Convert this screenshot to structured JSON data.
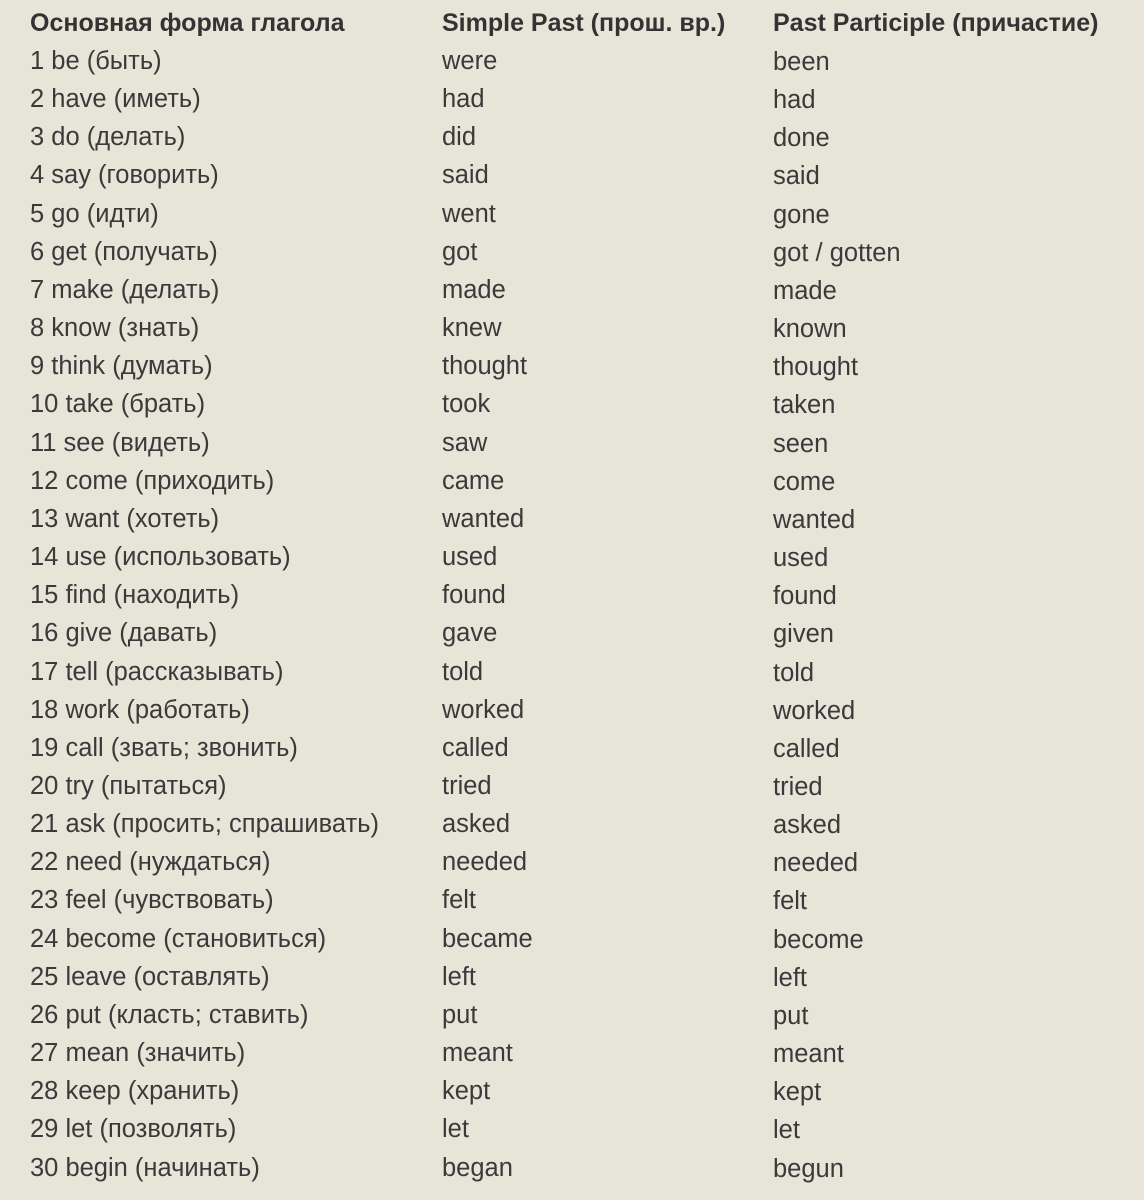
{
  "header": {
    "base": "Основная форма глагола",
    "past": "Simple Past (прош. вр.)",
    "participle": "Past Participle (причастие)"
  },
  "rows": [
    [
      "1 be (быть)",
      "were",
      "been"
    ],
    [
      "2 have (иметь)",
      "had",
      "had"
    ],
    [
      "3 do (делать)",
      "did",
      "done"
    ],
    [
      "4 say (говорить)",
      "said",
      "said"
    ],
    [
      "5 go (идти)",
      "went",
      "gone"
    ],
    [
      "6 get (получать)",
      "got",
      "got / gotten"
    ],
    [
      "7 make (делать)",
      "made",
      "made"
    ],
    [
      "8 know (знать)",
      "knew",
      "known"
    ],
    [
      "9 think (думать)",
      "thought",
      "thought"
    ],
    [
      "10 take (брать)",
      "took",
      "taken"
    ],
    [
      "11 see (видеть)",
      "saw",
      "seen"
    ],
    [
      "12 come (приходить)",
      "came",
      "come"
    ],
    [
      "13 want (хотеть)",
      "wanted",
      "wanted"
    ],
    [
      "14 use (использовать)",
      "used",
      "used"
    ],
    [
      "15 find (находить)",
      "found",
      "found"
    ],
    [
      "16 give (давать)",
      "gave",
      "given"
    ],
    [
      "17 tell (рассказывать)",
      "told",
      "told"
    ],
    [
      "18 work (работать)",
      "worked",
      "worked"
    ],
    [
      "19 call (звать; звонить)",
      "called",
      "called"
    ],
    [
      "20 try (пытаться)",
      "tried",
      "tried"
    ],
    [
      "21 ask (просить; спрашивать)",
      "asked",
      "asked"
    ],
    [
      "22 need (нуждаться)",
      "needed",
      "needed"
    ],
    [
      "23 feel (чувствовать)",
      "felt",
      "felt"
    ],
    [
      "24 become (становиться)",
      "became",
      "become"
    ],
    [
      "25 leave (оставлять)",
      "left",
      "left"
    ],
    [
      "26 put (класть; ставить)",
      "put",
      "put"
    ],
    [
      "27 mean (значить)",
      "meant",
      "meant"
    ],
    [
      "28 keep (хранить)",
      "kept",
      "kept"
    ],
    [
      "29 let (позволять)",
      "let",
      "let"
    ],
    [
      "30 begin (начинать)",
      "began",
      "begun"
    ]
  ]
}
